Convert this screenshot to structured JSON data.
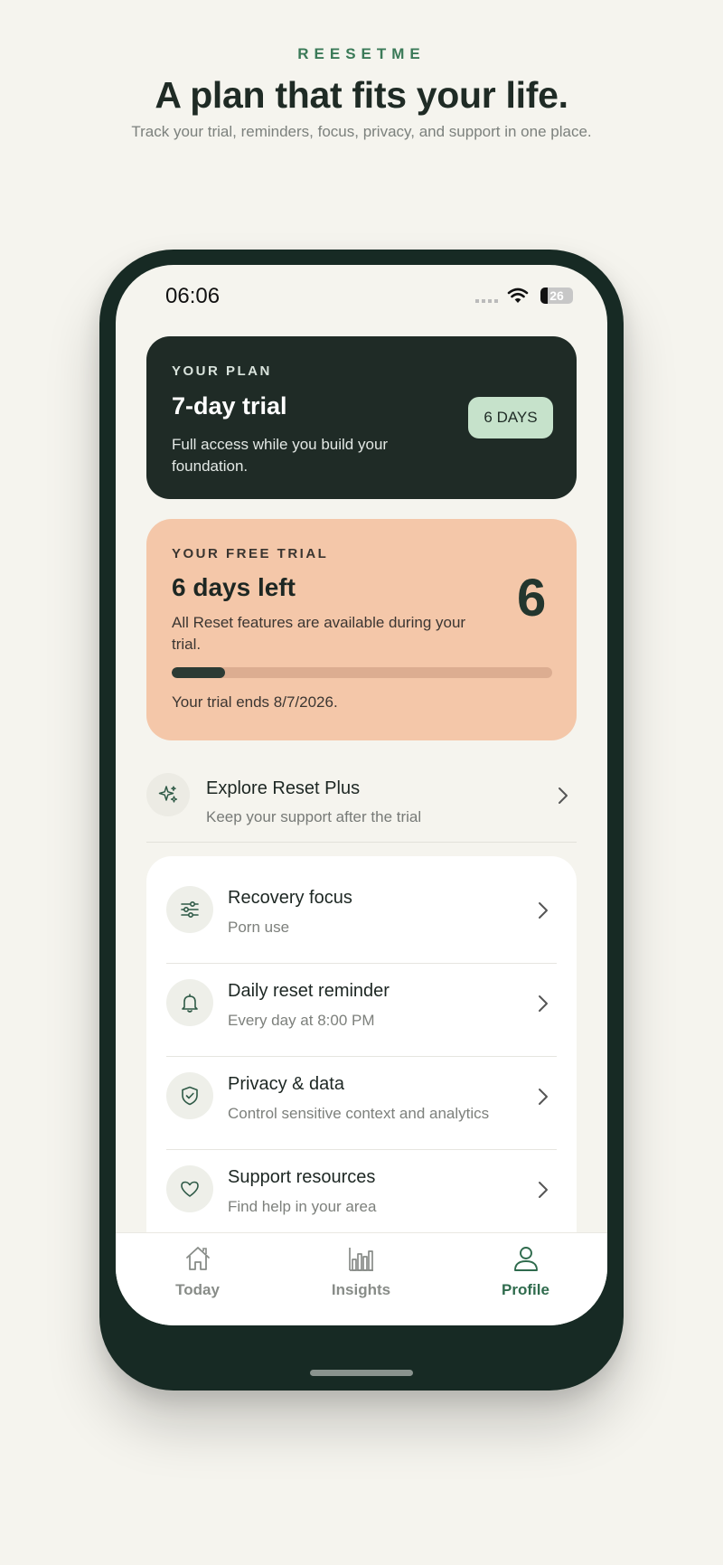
{
  "brand": "REESETME",
  "headline": "A plan that fits your life.",
  "subhead": "Track your trial, reminders, focus, privacy, and support in one place.",
  "status_bar": {
    "time": "06:06",
    "battery": "26"
  },
  "plan_card": {
    "label": "YOUR PLAN",
    "title": "7-day trial",
    "description": "Full access while you build your foundation.",
    "badge": "6 DAYS"
  },
  "trial_card": {
    "label": "YOUR FREE TRIAL",
    "title": "6 days left",
    "description": "All Reset features are available during your trial.",
    "days_number": "6",
    "progress_fraction": 0.14,
    "end_text": "Your trial ends 8/7/2026."
  },
  "explore": {
    "title": "Explore Reset Plus",
    "subtitle": "Keep your support after the trial",
    "icon": "sparkles-icon"
  },
  "settings": [
    {
      "title": "Recovery focus",
      "subtitle": "Porn use",
      "icon": "sliders-icon"
    },
    {
      "title": "Daily reset reminder",
      "subtitle": "Every day at 8:00 PM",
      "icon": "bell-icon"
    },
    {
      "title": "Privacy & data",
      "subtitle": "Control sensitive context and analytics",
      "icon": "shield-check-icon"
    },
    {
      "title": "Support resources",
      "subtitle": "Find help in your area",
      "icon": "heart-icon"
    }
  ],
  "tabs": [
    {
      "label": "Today",
      "icon": "home-icon",
      "active": false
    },
    {
      "label": "Insights",
      "icon": "bar-chart-icon",
      "active": false
    },
    {
      "label": "Profile",
      "icon": "user-icon",
      "active": true
    }
  ],
  "colors": {
    "accent": "#2f6b4d",
    "dark": "#1f2b26",
    "trial_bg": "#f4c7a9",
    "badge_bg": "#c6e2cb"
  }
}
